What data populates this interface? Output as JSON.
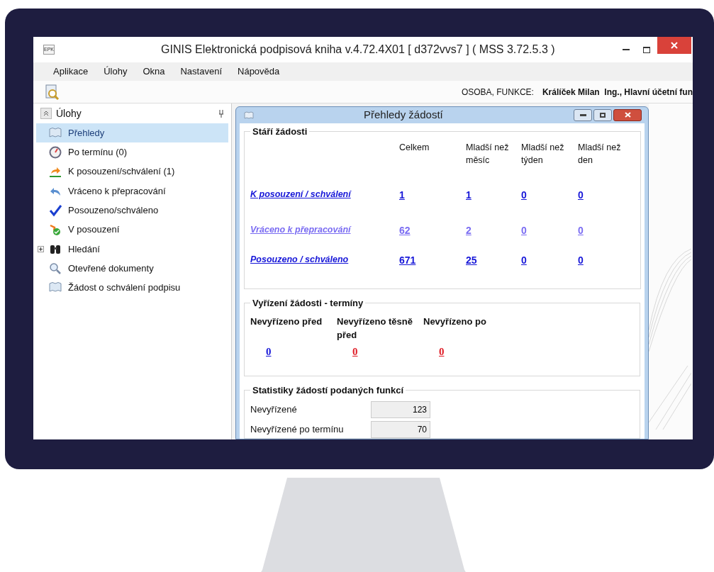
{
  "window": {
    "icon_text": "EPK",
    "title": "GINIS Elektronická podpisová kniha v.4.72.4X01 [ d372vvs7 ] ( MSS 3.72.5.3 )"
  },
  "menu": [
    "Aplikace",
    "Úlohy",
    "Okna",
    "Nastavení",
    "Nápověda"
  ],
  "toolbar": {
    "user_label": "OSOBA, FUNKCE:",
    "user_value": "Králíček Milan  Ing., Hlavní účetní fun"
  },
  "sidebar": {
    "title": "Úlohy",
    "items": [
      {
        "label": "Přehledy",
        "kind": "item",
        "selected": true
      },
      {
        "label": "Po termínu (0)",
        "kind": "item",
        "selected": false
      },
      {
        "label": "K posouzení/schválení (1)",
        "kind": "item",
        "selected": false
      },
      {
        "label": "Vráceno k přepracování",
        "kind": "item",
        "selected": false
      },
      {
        "label": "Posouzeno/schváleno",
        "kind": "item",
        "selected": false
      },
      {
        "label": "V posouzení",
        "kind": "item",
        "selected": false
      },
      {
        "label": "Hledání",
        "kind": "group",
        "expanded": false,
        "selected": false
      },
      {
        "label": "Otevřené dokumenty",
        "kind": "item",
        "selected": false
      },
      {
        "label": "Žádost o schválení podpisu",
        "kind": "item",
        "selected": false
      }
    ]
  },
  "dialog": {
    "title": "Přehledy žádostí",
    "age": {
      "title": "Stáří žádosti",
      "columns": [
        "Celkem",
        "Mladší než měsíc",
        "Mladší než týden",
        "Mladší než den"
      ],
      "rows": [
        {
          "label": "K posouzení / schválení",
          "visited": false,
          "values": [
            "1",
            "1",
            "0",
            "0"
          ]
        },
        {
          "label": "Vráceno k přepracování",
          "visited": true,
          "values": [
            "62",
            "2",
            "0",
            "0"
          ]
        },
        {
          "label": "Posouzeno / schváleno",
          "visited": false,
          "values": [
            "671",
            "25",
            "0",
            "0"
          ]
        }
      ]
    },
    "terms": {
      "title": "Vyřízení žádosti - termíny",
      "items": [
        {
          "label": "Nevyřízeno před",
          "value": "0",
          "color": "#1a1ad8"
        },
        {
          "label": "Nevyřízeno těsně před",
          "value": "0",
          "color": "#e0202a"
        },
        {
          "label": "Nevyřízeno po",
          "value": "0",
          "color": "#e0202a"
        }
      ]
    },
    "stats": {
      "title": "Statistiky žádostí podaných funkcí",
      "rows": [
        {
          "label": "Nevyřízené",
          "value": "123"
        },
        {
          "label": "Nevyřízené po termínu",
          "value": "70"
        }
      ]
    }
  }
}
